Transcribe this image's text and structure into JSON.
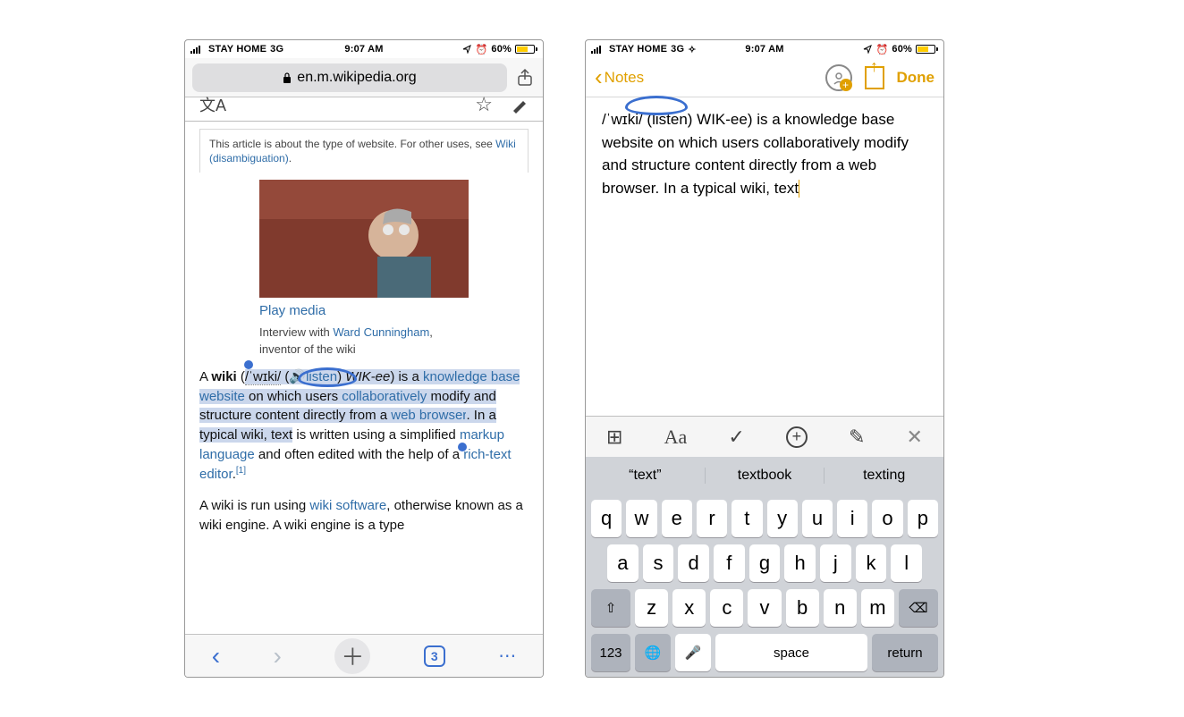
{
  "status": {
    "carrier": "STAY HOME",
    "net": "3G",
    "time": "9:07 AM",
    "batt": "60%"
  },
  "safari": {
    "url": "en.m.wikipedia.org",
    "hatnote1": "This article is about the type of website. For other uses, see ",
    "hatnote_link": "Wiki (disambiguation)",
    "playmedia": "Play media",
    "cap1": "Interview with ",
    "cap_link": "Ward Cunningham",
    "cap2": ", inventor of the wiki",
    "p": {
      "a": "A ",
      "wiki": "wiki",
      "open": " (",
      "ipa": "/ˈwɪki/",
      "sp": " (",
      "listen": "listen",
      "close": ") ",
      "phon": "WIK-ee",
      "isA": ") is a ",
      "kb": "knowledge base",
      "site": "website",
      "onw": " on which users ",
      "collab": "collaboratively",
      "mod": " modify and structure content directly from a ",
      "wb": "web browser",
      "in": ". In a typical wiki, text",
      "writ": " is written using a simplified ",
      "ml": "markup language",
      "help": " and often edited with the help of a ",
      "rte": "rich-text editor",
      "dot": ".",
      "ref": "[1]"
    },
    "p2": {
      "a": "A wiki is run using ",
      "ws": "wiki software",
      "b": ", otherwise known as a wiki engine. A wiki engine is a type"
    },
    "tabcount": "3"
  },
  "notes": {
    "back": "Notes",
    "done": "Done",
    "text": "/ˈwɪki/ (listen) WIK-ee) is a knowledge base website on which users collaboratively modify and structure content directly from a web browser. In a typical wiki, text",
    "pred": [
      "“text”",
      "textbook",
      "texting"
    ]
  },
  "kbd": {
    "r1": [
      "q",
      "w",
      "e",
      "r",
      "t",
      "y",
      "u",
      "i",
      "o",
      "p"
    ],
    "r2": [
      "a",
      "s",
      "d",
      "f",
      "g",
      "h",
      "j",
      "k",
      "l"
    ],
    "r3": [
      "z",
      "x",
      "c",
      "v",
      "b",
      "n",
      "m"
    ],
    "num": "123",
    "space": "space",
    "ret": "return"
  }
}
